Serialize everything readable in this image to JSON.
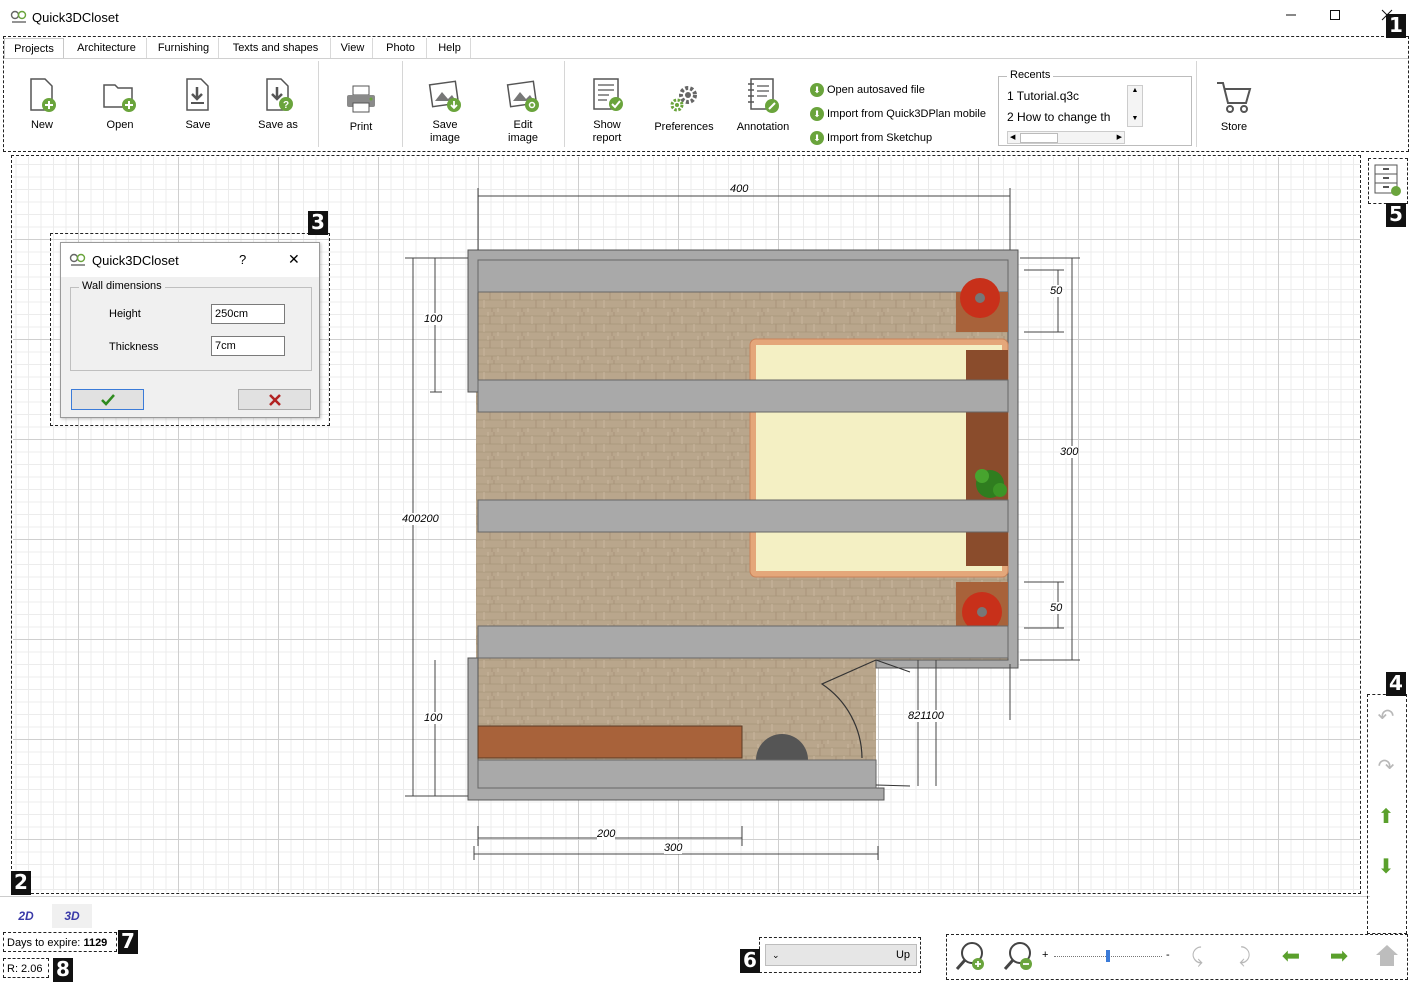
{
  "window": {
    "title": "Quick3DCloset",
    "minimize_icon": "minimize-icon",
    "maximize_icon": "maximize-icon",
    "close_icon": "close-icon"
  },
  "ribbon": {
    "tabs": [
      {
        "label": "Projects",
        "active": true
      },
      {
        "label": "Architecture"
      },
      {
        "label": "Furnishing"
      },
      {
        "label": "Texts and shapes"
      },
      {
        "label": "View"
      },
      {
        "label": "Photo"
      },
      {
        "label": "Help"
      }
    ],
    "buttons": {
      "new": "New",
      "open": "Open",
      "save": "Save",
      "save_as": "Save as",
      "print": "Print",
      "save_image_1": "Save",
      "save_image_2": "image",
      "edit_image_1": "Edit",
      "edit_image_2": "image",
      "show_report_1": "Show",
      "show_report_2": "report",
      "preferences": "Preferences",
      "annotation": "Annotation",
      "store": "Store"
    },
    "links": {
      "open_autosaved": "Open autosaved file",
      "import_mobile": "Import from Quick3DPlan mobile",
      "import_sketchup": "Import from Sketchup"
    },
    "recents": {
      "legend": "Recents",
      "items": [
        "1 Tutorial.q3c",
        "2 How to change th"
      ]
    }
  },
  "callouts": [
    "1",
    "2",
    "3",
    "4",
    "5",
    "6",
    "7",
    "8"
  ],
  "dialog": {
    "title": "Quick3DCloset",
    "help": "?",
    "close": "✕",
    "group_label": "Wall dimensions",
    "height_label": "Height",
    "height_value": "250cm",
    "thickness_label": "Thickness",
    "thickness_value": "7cm",
    "ok_icon": "checkmark-icon",
    "cancel_icon": "cross-icon"
  },
  "dimensions": {
    "top_width": "400",
    "left_top": "100",
    "left_total": "400200",
    "left_bottom": "100",
    "right_top": "50",
    "right_middle": "300",
    "right_bottom": "50",
    "bottom_inner": "200",
    "bottom_outer": "300",
    "door": "821100"
  },
  "view_tabs": {
    "tab_2d": "2D",
    "tab_3d": "3D"
  },
  "status": {
    "days_label": "Days to expire:",
    "days_value": "1129",
    "release": "R: 2.06"
  },
  "level_select": {
    "value": "Up"
  },
  "colors": {
    "accent_green": "#6aa43c",
    "wall_gray": "#a9a9a9",
    "floor_wood": "#b9a68c",
    "bed_cream": "#f4f0c4",
    "bed_frame": "#e4a77a",
    "wood_brown": "#a8623a"
  }
}
